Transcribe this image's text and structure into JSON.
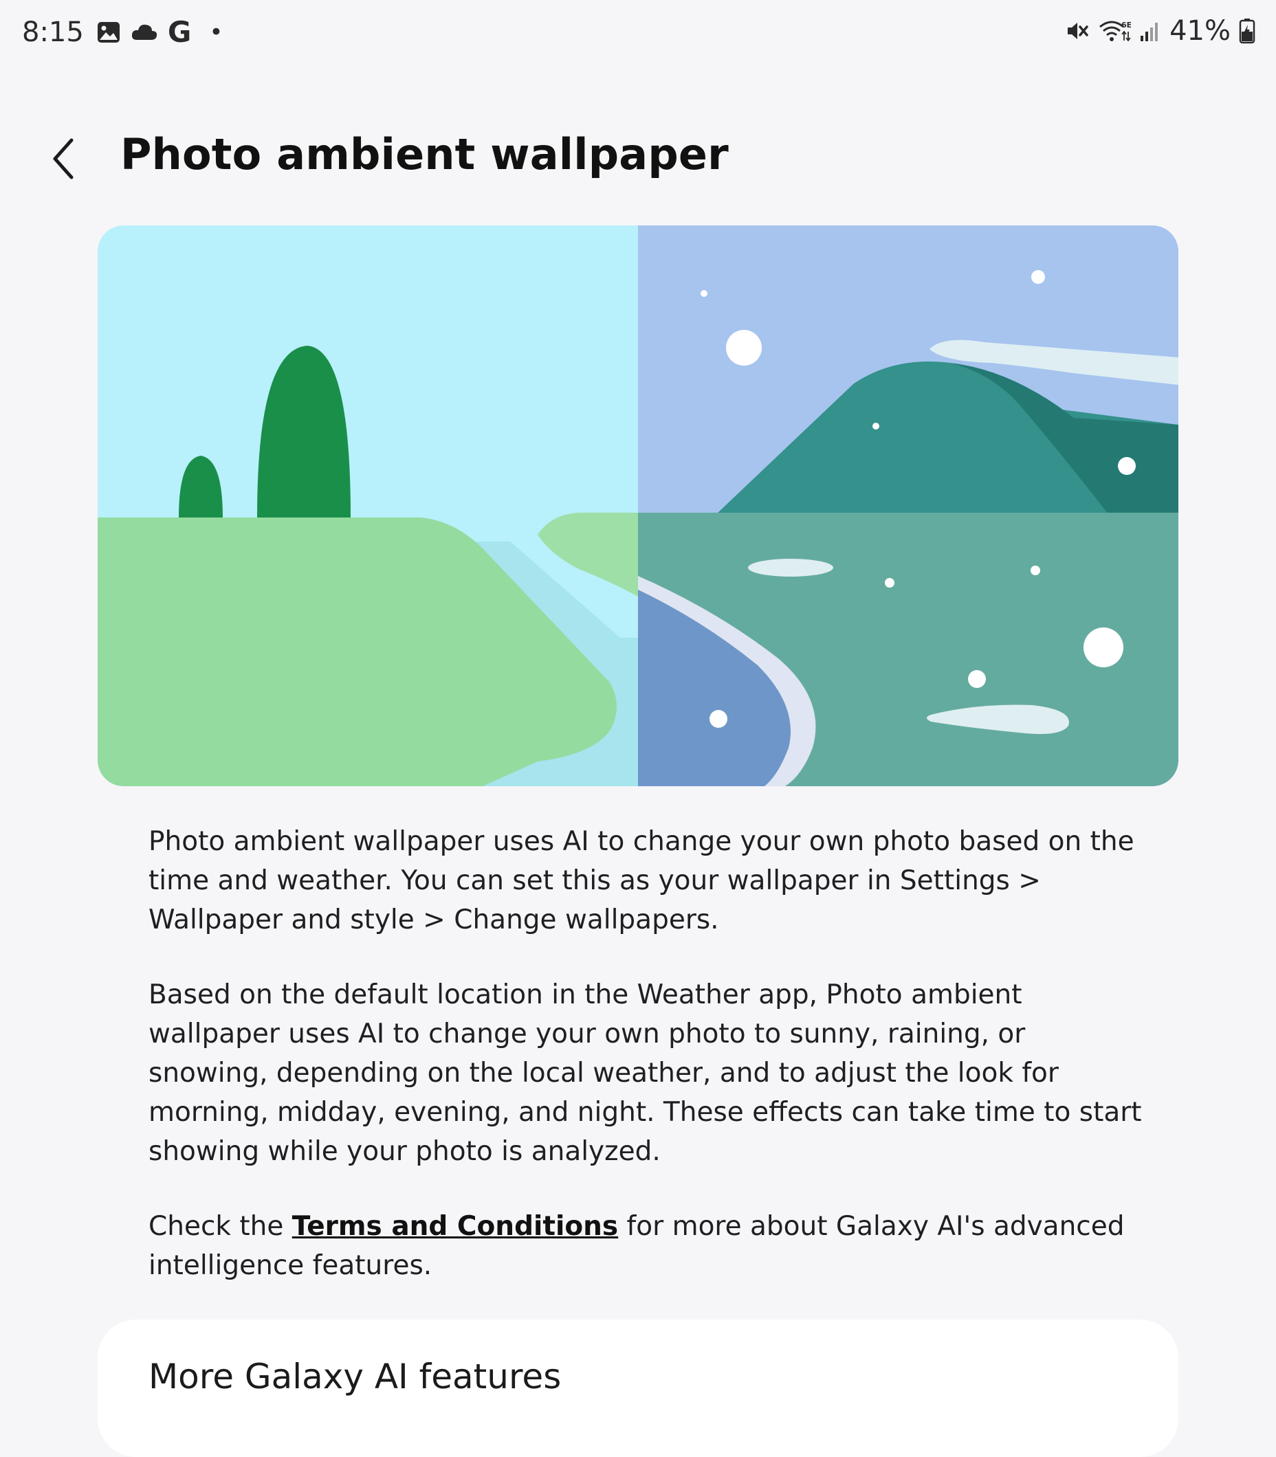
{
  "status_bar": {
    "time": "8:15",
    "google_glyph": "G",
    "dot": "•",
    "battery": "41%",
    "icons": [
      "gallery-icon",
      "cloud-icon",
      "google-icon",
      "mute-icon",
      "wifi-6e-icon",
      "signal-icon",
      "battery-icon"
    ]
  },
  "header": {
    "title": "Photo ambient wallpaper"
  },
  "body": {
    "paragraph1": "Photo ambient wallpaper uses AI to change your own photo based on the time and weather. You can set this as your wallpaper in Settings > Wallpaper and style > Change wallpapers.",
    "paragraph2": "Based on the default location in the Weather app, Photo ambient wallpaper uses AI to change your own photo to sunny, raining, or snowing, depending on the local weather, and to adjust the look for morning, midday, evening, and night. These effects can take time to start showing while your photo is analyzed.",
    "paragraph3_prefix": "Check the ",
    "terms_link": "Terms and Conditions",
    "paragraph3_suffix": " for more about Galaxy AI's advanced intelligence features."
  },
  "more_features": {
    "label": "More Galaxy AI features"
  },
  "colors": {
    "background": "#f6f6f8",
    "sky_day": "#b8f0fb",
    "sky_night": "#a6c4ee",
    "grass": "#94dba0",
    "tree": "#1a8f4a",
    "mountain": "#34918b",
    "lake": "#64ab9f"
  }
}
